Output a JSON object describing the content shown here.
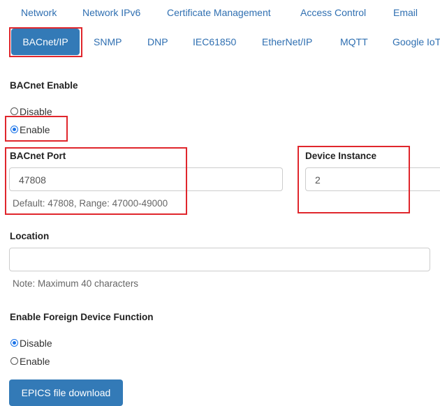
{
  "top_tabs": [
    "Network",
    "Network IPv6",
    "Certificate Management",
    "Access Control",
    "Email"
  ],
  "protocol_tabs": {
    "active": "BACnet/IP",
    "others": [
      "SNMP",
      "DNP",
      "IEC61850",
      "EtherNet/IP",
      "MQTT",
      "Google IoT"
    ]
  },
  "bacnet_enable": {
    "label": "BACnet Enable",
    "options": [
      "Disable",
      "Enable"
    ],
    "selected": "Enable"
  },
  "bacnet_port": {
    "label": "BACnet Port",
    "value": "47808",
    "help": "Default: 47808, Range: 47000-49000"
  },
  "device_instance": {
    "label": "Device Instance",
    "value": "2"
  },
  "location": {
    "label": "Location",
    "value": "",
    "note": "Note: Maximum 40 characters"
  },
  "foreign_device": {
    "label": "Enable Foreign Device Function",
    "options": [
      "Disable",
      "Enable"
    ],
    "selected": "Disable"
  },
  "epics_button": "EPICS file download",
  "colors": {
    "accent": "#337ab7",
    "link": "#2f6fb1",
    "highlight_box": "#e0262c",
    "radio_selected": "#1a73e8"
  }
}
